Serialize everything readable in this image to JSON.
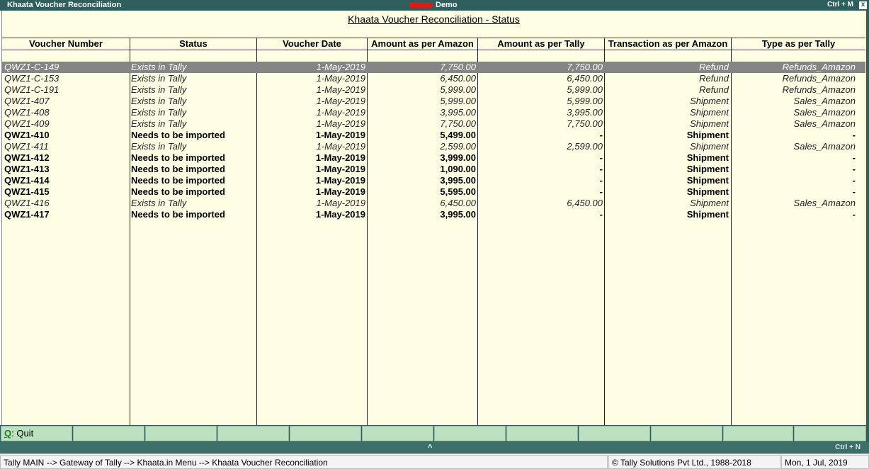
{
  "window": {
    "title": "Khaata Voucher Reconciliation",
    "company_suffix": "Demo",
    "shortcut": "Ctrl + M",
    "close_glyph": "x"
  },
  "report": {
    "title": "Khaata Voucher Reconciliation - Status",
    "columns": [
      "Voucher Number",
      "Status",
      "Voucher Date",
      "Amount as per Amazon",
      "Amount as per Tally",
      "Transaction as per Amazon",
      "Type as per Tally"
    ],
    "rows": [
      {
        "voucher": "QWZ1-C-149",
        "status": "Exists in Tally",
        "date": "1-May-2019",
        "amazon": "7,750.00",
        "tally": "7,750.00",
        "txn": "Refund",
        "type": "Refunds_Amazon",
        "style": "sel"
      },
      {
        "voucher": "QWZ1-C-153",
        "status": "Exists in Tally",
        "date": "1-May-2019",
        "amazon": "6,450.00",
        "tally": "6,450.00",
        "txn": "Refund",
        "type": "Refunds_Amazon",
        "style": ""
      },
      {
        "voucher": "QWZ1-C-191",
        "status": "Exists in Tally",
        "date": "1-May-2019",
        "amazon": "5,999.00",
        "tally": "5,999.00",
        "txn": "Refund",
        "type": "Refunds_Amazon",
        "style": ""
      },
      {
        "voucher": "QWZ1-407",
        "status": "Exists in Tally",
        "date": "1-May-2019",
        "amazon": "5,999.00",
        "tally": "5,999.00",
        "txn": "Shipment",
        "type": "Sales_Amazon",
        "style": ""
      },
      {
        "voucher": "QWZ1-408",
        "status": "Exists in Tally",
        "date": "1-May-2019",
        "amazon": "3,995.00",
        "tally": "3,995.00",
        "txn": "Shipment",
        "type": "Sales_Amazon",
        "style": ""
      },
      {
        "voucher": "QWZ1-409",
        "status": "Exists in Tally",
        "date": "1-May-2019",
        "amazon": "7,750.00",
        "tally": "7,750.00",
        "txn": "Shipment",
        "type": "Sales_Amazon",
        "style": ""
      },
      {
        "voucher": "QWZ1-410",
        "status": "Needs to be imported",
        "date": "1-May-2019",
        "amazon": "5,499.00",
        "tally": "-",
        "txn": "Shipment",
        "type": "-",
        "style": "bold"
      },
      {
        "voucher": "QWZ1-411",
        "status": "Exists in Tally",
        "date": "1-May-2019",
        "amazon": "2,599.00",
        "tally": "2,599.00",
        "txn": "Shipment",
        "type": "Sales_Amazon",
        "style": ""
      },
      {
        "voucher": "QWZ1-412",
        "status": "Needs to be imported",
        "date": "1-May-2019",
        "amazon": "3,999.00",
        "tally": "-",
        "txn": "Shipment",
        "type": "-",
        "style": "bold"
      },
      {
        "voucher": "QWZ1-413",
        "status": "Needs to be imported",
        "date": "1-May-2019",
        "amazon": "1,090.00",
        "tally": "-",
        "txn": "Shipment",
        "type": "-",
        "style": "bold"
      },
      {
        "voucher": "QWZ1-414",
        "status": "Needs to be imported",
        "date": "1-May-2019",
        "amazon": "3,995.00",
        "tally": "-",
        "txn": "Shipment",
        "type": "-",
        "style": "bold"
      },
      {
        "voucher": "QWZ1-415",
        "status": "Needs to be imported",
        "date": "1-May-2019",
        "amazon": "5,595.00",
        "tally": "-",
        "txn": "Shipment",
        "type": "-",
        "style": "bold"
      },
      {
        "voucher": "QWZ1-416",
        "status": "Exists in Tally",
        "date": "1-May-2019",
        "amazon": "6,450.00",
        "tally": "6,450.00",
        "txn": "Shipment",
        "type": "Sales_Amazon",
        "style": ""
      },
      {
        "voucher": "QWZ1-417",
        "status": "Needs to be imported",
        "date": "1-May-2019",
        "amazon": "3,995.00",
        "tally": "-",
        "txn": "Shipment",
        "type": "-",
        "style": "bold"
      }
    ]
  },
  "buttons": {
    "quit_key": "Q",
    "quit_label": ": Quit"
  },
  "lowbar": {
    "caret": "^",
    "shortcut": "Ctrl + N"
  },
  "status": {
    "path": "Tally MAIN --> Gateway of Tally --> Khaata.in Menu --> Khaata Voucher Reconciliation",
    "copyright": "© Tally Solutions Pvt Ltd., 1988-2018",
    "date": "Mon, 1 Jul, 2019"
  }
}
